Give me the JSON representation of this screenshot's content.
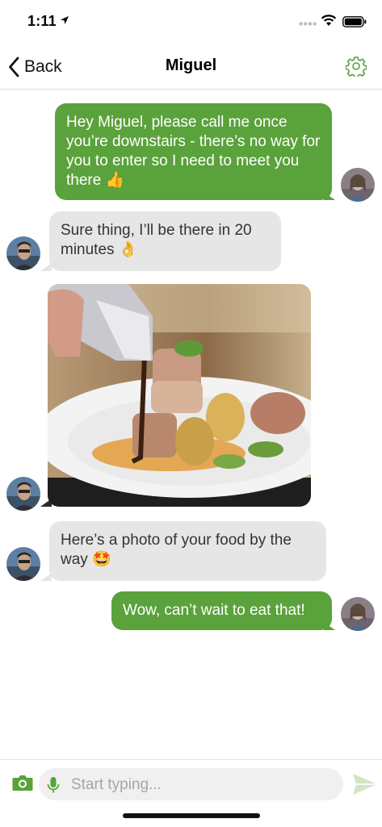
{
  "status_bar": {
    "time": "1:11"
  },
  "nav": {
    "back_label": "Back",
    "title": "Miguel"
  },
  "messages": [
    {
      "direction": "outgoing",
      "text": "Hey Miguel, please call me once you’re downstairs - there’s no way for you to enter so I need to meet you there 👍"
    },
    {
      "direction": "incoming",
      "text": "Sure thing, I’ll be there in 20 minutes 👌"
    },
    {
      "direction": "incoming",
      "type": "image"
    },
    {
      "direction": "incoming",
      "text": "Here’s a photo of your food by the way 🤩"
    },
    {
      "direction": "outgoing",
      "text": "Wow, can’t wait to eat that!"
    }
  ],
  "input": {
    "placeholder": "Start typing..."
  },
  "colors": {
    "outgoing_bubble": "#5aa23b",
    "incoming_bubble": "#e6e6e6",
    "accent": "#5aa23b"
  },
  "icons": [
    "location-arrow-icon",
    "wifi-icon",
    "battery-icon",
    "back-chevron-icon",
    "gear-icon",
    "camera-icon",
    "microphone-icon",
    "send-icon"
  ]
}
